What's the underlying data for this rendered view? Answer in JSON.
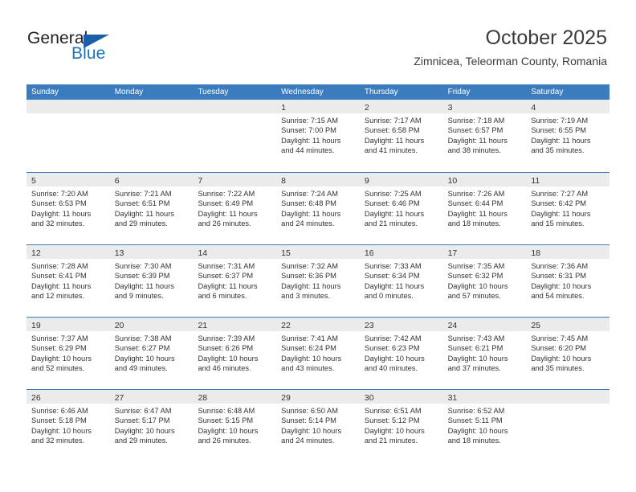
{
  "logo": {
    "word_one": "General",
    "word_two": "Blue",
    "triangle_icon": "triangle-icon"
  },
  "header": {
    "title": "October 2025",
    "subtitle": "Zimnicea, Teleorman County, Romania"
  },
  "colors": {
    "header_blue": "#3b7cbf",
    "day_band_gray": "#ebebeb",
    "logo_blue": "#1b75bc",
    "text": "#333333"
  },
  "calendar": {
    "day_names": [
      "Sunday",
      "Monday",
      "Tuesday",
      "Wednesday",
      "Thursday",
      "Friday",
      "Saturday"
    ],
    "weeks": [
      [
        {
          "day": "",
          "sunrise": "",
          "sunset": "",
          "daylight_1": "",
          "daylight_2": ""
        },
        {
          "day": "",
          "sunrise": "",
          "sunset": "",
          "daylight_1": "",
          "daylight_2": ""
        },
        {
          "day": "",
          "sunrise": "",
          "sunset": "",
          "daylight_1": "",
          "daylight_2": ""
        },
        {
          "day": "1",
          "sunrise": "Sunrise: 7:15 AM",
          "sunset": "Sunset: 7:00 PM",
          "daylight_1": "Daylight: 11 hours",
          "daylight_2": "and 44 minutes."
        },
        {
          "day": "2",
          "sunrise": "Sunrise: 7:17 AM",
          "sunset": "Sunset: 6:58 PM",
          "daylight_1": "Daylight: 11 hours",
          "daylight_2": "and 41 minutes."
        },
        {
          "day": "3",
          "sunrise": "Sunrise: 7:18 AM",
          "sunset": "Sunset: 6:57 PM",
          "daylight_1": "Daylight: 11 hours",
          "daylight_2": "and 38 minutes."
        },
        {
          "day": "4",
          "sunrise": "Sunrise: 7:19 AM",
          "sunset": "Sunset: 6:55 PM",
          "daylight_1": "Daylight: 11 hours",
          "daylight_2": "and 35 minutes."
        }
      ],
      [
        {
          "day": "5",
          "sunrise": "Sunrise: 7:20 AM",
          "sunset": "Sunset: 6:53 PM",
          "daylight_1": "Daylight: 11 hours",
          "daylight_2": "and 32 minutes."
        },
        {
          "day": "6",
          "sunrise": "Sunrise: 7:21 AM",
          "sunset": "Sunset: 6:51 PM",
          "daylight_1": "Daylight: 11 hours",
          "daylight_2": "and 29 minutes."
        },
        {
          "day": "7",
          "sunrise": "Sunrise: 7:22 AM",
          "sunset": "Sunset: 6:49 PM",
          "daylight_1": "Daylight: 11 hours",
          "daylight_2": "and 26 minutes."
        },
        {
          "day": "8",
          "sunrise": "Sunrise: 7:24 AM",
          "sunset": "Sunset: 6:48 PM",
          "daylight_1": "Daylight: 11 hours",
          "daylight_2": "and 24 minutes."
        },
        {
          "day": "9",
          "sunrise": "Sunrise: 7:25 AM",
          "sunset": "Sunset: 6:46 PM",
          "daylight_1": "Daylight: 11 hours",
          "daylight_2": "and 21 minutes."
        },
        {
          "day": "10",
          "sunrise": "Sunrise: 7:26 AM",
          "sunset": "Sunset: 6:44 PM",
          "daylight_1": "Daylight: 11 hours",
          "daylight_2": "and 18 minutes."
        },
        {
          "day": "11",
          "sunrise": "Sunrise: 7:27 AM",
          "sunset": "Sunset: 6:42 PM",
          "daylight_1": "Daylight: 11 hours",
          "daylight_2": "and 15 minutes."
        }
      ],
      [
        {
          "day": "12",
          "sunrise": "Sunrise: 7:28 AM",
          "sunset": "Sunset: 6:41 PM",
          "daylight_1": "Daylight: 11 hours",
          "daylight_2": "and 12 minutes."
        },
        {
          "day": "13",
          "sunrise": "Sunrise: 7:30 AM",
          "sunset": "Sunset: 6:39 PM",
          "daylight_1": "Daylight: 11 hours",
          "daylight_2": "and 9 minutes."
        },
        {
          "day": "14",
          "sunrise": "Sunrise: 7:31 AM",
          "sunset": "Sunset: 6:37 PM",
          "daylight_1": "Daylight: 11 hours",
          "daylight_2": "and 6 minutes."
        },
        {
          "day": "15",
          "sunrise": "Sunrise: 7:32 AM",
          "sunset": "Sunset: 6:36 PM",
          "daylight_1": "Daylight: 11 hours",
          "daylight_2": "and 3 minutes."
        },
        {
          "day": "16",
          "sunrise": "Sunrise: 7:33 AM",
          "sunset": "Sunset: 6:34 PM",
          "daylight_1": "Daylight: 11 hours",
          "daylight_2": "and 0 minutes."
        },
        {
          "day": "17",
          "sunrise": "Sunrise: 7:35 AM",
          "sunset": "Sunset: 6:32 PM",
          "daylight_1": "Daylight: 10 hours",
          "daylight_2": "and 57 minutes."
        },
        {
          "day": "18",
          "sunrise": "Sunrise: 7:36 AM",
          "sunset": "Sunset: 6:31 PM",
          "daylight_1": "Daylight: 10 hours",
          "daylight_2": "and 54 minutes."
        }
      ],
      [
        {
          "day": "19",
          "sunrise": "Sunrise: 7:37 AM",
          "sunset": "Sunset: 6:29 PM",
          "daylight_1": "Daylight: 10 hours",
          "daylight_2": "and 52 minutes."
        },
        {
          "day": "20",
          "sunrise": "Sunrise: 7:38 AM",
          "sunset": "Sunset: 6:27 PM",
          "daylight_1": "Daylight: 10 hours",
          "daylight_2": "and 49 minutes."
        },
        {
          "day": "21",
          "sunrise": "Sunrise: 7:39 AM",
          "sunset": "Sunset: 6:26 PM",
          "daylight_1": "Daylight: 10 hours",
          "daylight_2": "and 46 minutes."
        },
        {
          "day": "22",
          "sunrise": "Sunrise: 7:41 AM",
          "sunset": "Sunset: 6:24 PM",
          "daylight_1": "Daylight: 10 hours",
          "daylight_2": "and 43 minutes."
        },
        {
          "day": "23",
          "sunrise": "Sunrise: 7:42 AM",
          "sunset": "Sunset: 6:23 PM",
          "daylight_1": "Daylight: 10 hours",
          "daylight_2": "and 40 minutes."
        },
        {
          "day": "24",
          "sunrise": "Sunrise: 7:43 AM",
          "sunset": "Sunset: 6:21 PM",
          "daylight_1": "Daylight: 10 hours",
          "daylight_2": "and 37 minutes."
        },
        {
          "day": "25",
          "sunrise": "Sunrise: 7:45 AM",
          "sunset": "Sunset: 6:20 PM",
          "daylight_1": "Daylight: 10 hours",
          "daylight_2": "and 35 minutes."
        }
      ],
      [
        {
          "day": "26",
          "sunrise": "Sunrise: 6:46 AM",
          "sunset": "Sunset: 5:18 PM",
          "daylight_1": "Daylight: 10 hours",
          "daylight_2": "and 32 minutes."
        },
        {
          "day": "27",
          "sunrise": "Sunrise: 6:47 AM",
          "sunset": "Sunset: 5:17 PM",
          "daylight_1": "Daylight: 10 hours",
          "daylight_2": "and 29 minutes."
        },
        {
          "day": "28",
          "sunrise": "Sunrise: 6:48 AM",
          "sunset": "Sunset: 5:15 PM",
          "daylight_1": "Daylight: 10 hours",
          "daylight_2": "and 26 minutes."
        },
        {
          "day": "29",
          "sunrise": "Sunrise: 6:50 AM",
          "sunset": "Sunset: 5:14 PM",
          "daylight_1": "Daylight: 10 hours",
          "daylight_2": "and 24 minutes."
        },
        {
          "day": "30",
          "sunrise": "Sunrise: 6:51 AM",
          "sunset": "Sunset: 5:12 PM",
          "daylight_1": "Daylight: 10 hours",
          "daylight_2": "and 21 minutes."
        },
        {
          "day": "31",
          "sunrise": "Sunrise: 6:52 AM",
          "sunset": "Sunset: 5:11 PM",
          "daylight_1": "Daylight: 10 hours",
          "daylight_2": "and 18 minutes."
        },
        {
          "day": "",
          "sunrise": "",
          "sunset": "",
          "daylight_1": "",
          "daylight_2": ""
        }
      ]
    ]
  }
}
